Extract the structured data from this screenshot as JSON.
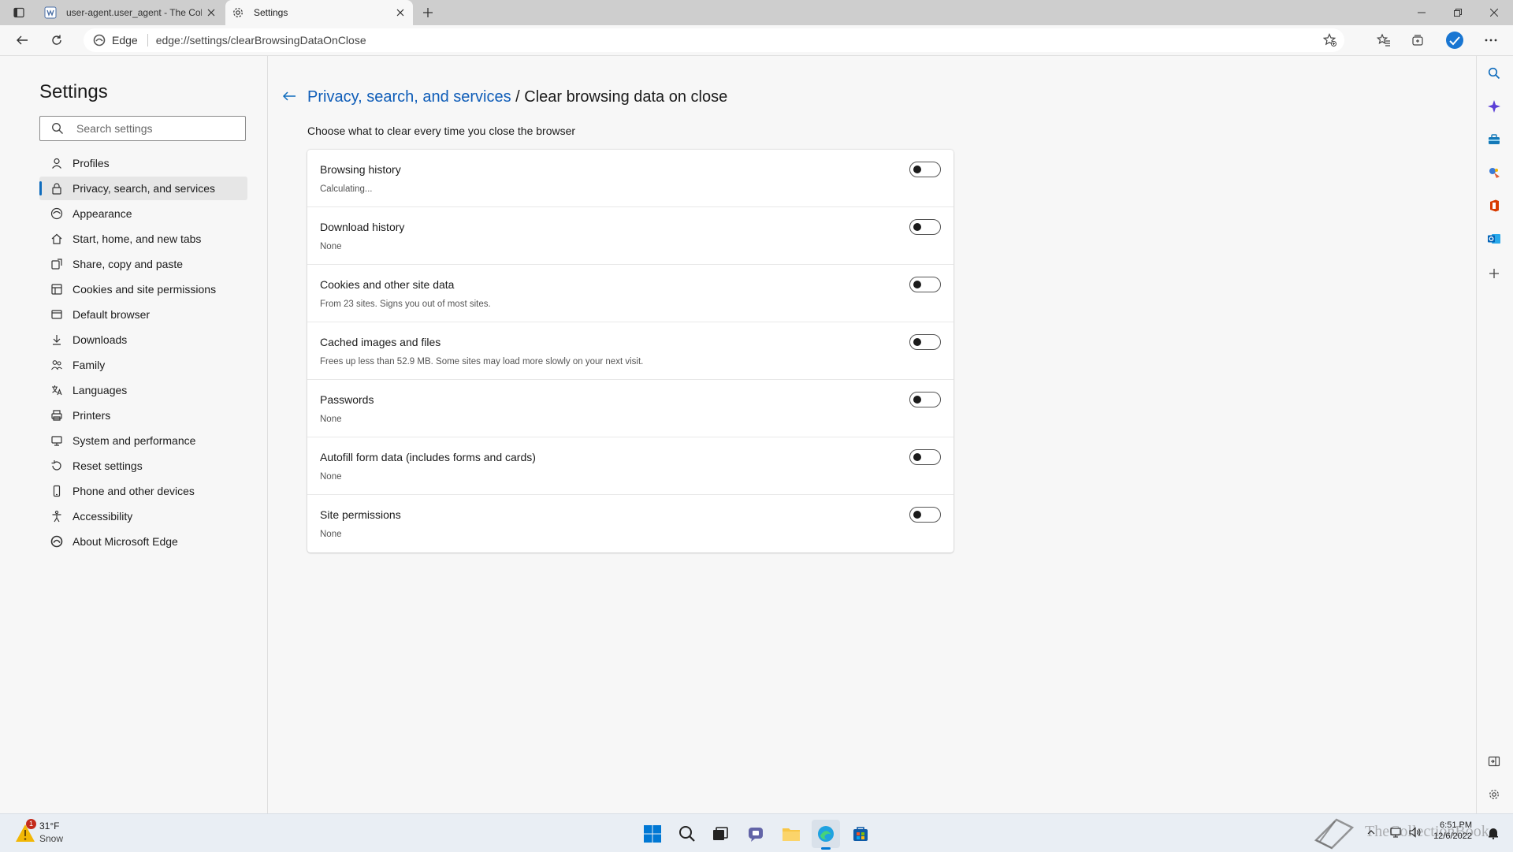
{
  "tabs": [
    {
      "title": "user-agent.user_agent - The Coll",
      "icon": "wiki-icon",
      "active": false
    },
    {
      "title": "Settings",
      "icon": "gear-icon",
      "active": true
    }
  ],
  "address_bar": {
    "site_label": "Edge",
    "url": "edge://settings/clearBrowsingDataOnClose"
  },
  "sidebar": {
    "title": "Settings",
    "search_placeholder": "Search settings",
    "items": [
      {
        "label": "Profiles",
        "icon": "profile-icon"
      },
      {
        "label": "Privacy, search, and services",
        "icon": "lock-icon",
        "active": true
      },
      {
        "label": "Appearance",
        "icon": "appearance-icon"
      },
      {
        "label": "Start, home, and new tabs",
        "icon": "home-icon"
      },
      {
        "label": "Share, copy and paste",
        "icon": "share-icon"
      },
      {
        "label": "Cookies and site permissions",
        "icon": "cookies-icon"
      },
      {
        "label": "Default browser",
        "icon": "browser-icon"
      },
      {
        "label": "Downloads",
        "icon": "download-icon"
      },
      {
        "label": "Family",
        "icon": "family-icon"
      },
      {
        "label": "Languages",
        "icon": "language-icon"
      },
      {
        "label": "Printers",
        "icon": "printer-icon"
      },
      {
        "label": "System and performance",
        "icon": "system-icon"
      },
      {
        "label": "Reset settings",
        "icon": "reset-icon"
      },
      {
        "label": "Phone and other devices",
        "icon": "phone-icon"
      },
      {
        "label": "Accessibility",
        "icon": "accessibility-icon"
      },
      {
        "label": "About Microsoft Edge",
        "icon": "edge-icon"
      }
    ]
  },
  "main": {
    "breadcrumb_parent": "Privacy, search, and services",
    "breadcrumb_separator": " / ",
    "breadcrumb_current": "Clear browsing data on close",
    "intro": "Choose what to clear every time you close the browser",
    "rows": [
      {
        "label": "Browsing history",
        "sub": "Calculating...",
        "enabled": false
      },
      {
        "label": "Download history",
        "sub": "None",
        "enabled": false
      },
      {
        "label": "Cookies and other site data",
        "sub": "From 23 sites. Signs you out of most sites.",
        "enabled": false
      },
      {
        "label": "Cached images and files",
        "sub": "Frees up less than 52.9 MB. Some sites may load more slowly on your next visit.",
        "enabled": false
      },
      {
        "label": "Passwords",
        "sub": "None",
        "enabled": false
      },
      {
        "label": "Autofill form data (includes forms and cards)",
        "sub": "None",
        "enabled": false
      },
      {
        "label": "Site permissions",
        "sub": "None",
        "enabled": false
      }
    ]
  },
  "taskbar": {
    "weather_temp": "31°F",
    "weather_condition": "Snow",
    "weather_badge": "1",
    "time": "6:51 PM",
    "date": "12/6/2022",
    "watermark": "TheCollectionBook"
  },
  "colors": {
    "accent": "#0f6cbd",
    "link": "#0f5db8",
    "background": "#f7f7f7",
    "card": "#ffffff",
    "titlebar": "#cecece",
    "taskbar": "#e9eef4"
  }
}
